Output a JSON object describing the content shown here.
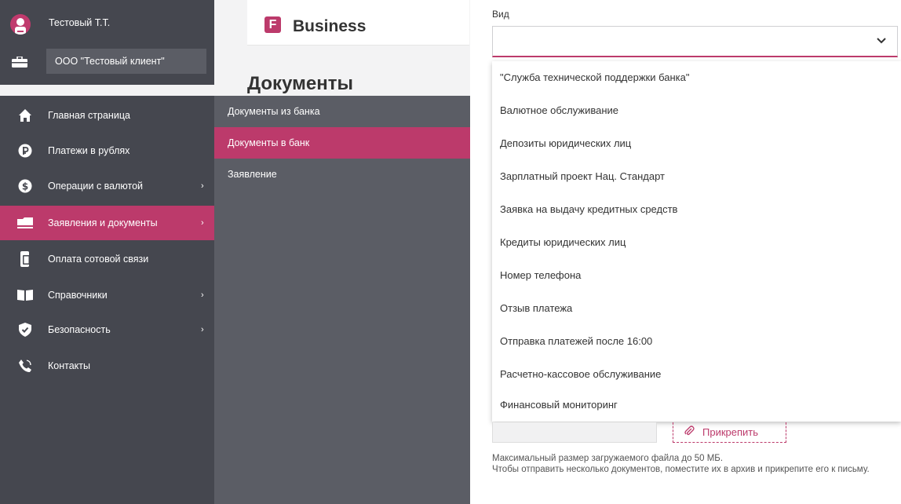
{
  "profile": {
    "user_name": "Тестовый Т.Т.",
    "client_name": "ООО \"Тестовый клиент\""
  },
  "header": {
    "brand_letter": "F",
    "brand_name": "Business",
    "page_title": "Документы"
  },
  "nav": {
    "items": [
      {
        "label": "Главная страница",
        "icon": "home-icon"
      },
      {
        "label": "Платежи в рублях",
        "icon": "ruble-icon"
      },
      {
        "label": "Операции с валютой",
        "icon": "dollar-icon",
        "arrow": "›"
      },
      {
        "label": "Заявления и документы",
        "icon": "folder-icon",
        "arrow": "›",
        "active": true
      },
      {
        "label": "Оплата сотовой связи",
        "icon": "mobile-phone-icon"
      },
      {
        "label": "Справочники",
        "icon": "book-icon",
        "arrow": "›"
      },
      {
        "label": "Безопасность",
        "icon": "shield-icon",
        "arrow": "›"
      },
      {
        "label": "Контакты",
        "icon": "phone-icon"
      }
    ]
  },
  "submenu": {
    "items": [
      {
        "label": "Документы из банка"
      },
      {
        "label": "Документы в банк",
        "active": true
      },
      {
        "label": "Заявление"
      }
    ]
  },
  "form": {
    "vid_label": "Вид",
    "select_value": "",
    "options": [
      "\"Служба технической поддержки банка\"",
      "Валютное обслуживание",
      "Депозиты юридических лиц",
      "Зарплатный проект Нац. Стандарт",
      "Заявка на выдачу кредитных средств",
      "Кредиты юридических лиц",
      "Номер телефона",
      "Отзыв платежа",
      "Отправка платежей после 16:00",
      "Расчетно-кассовое обслуживание",
      "Финансовый мониторинг"
    ],
    "attach_label": "Прикрепить",
    "note_line1": "Максимальный размер загружаемого файла до 50 МБ.",
    "note_line2": "Чтобы отправить несколько документов, поместите их в архив и прикрепите его к письму."
  },
  "colors": {
    "accent": "#bc3a6b",
    "sidebar": "#45474f",
    "submenu": "#5b5d65"
  }
}
